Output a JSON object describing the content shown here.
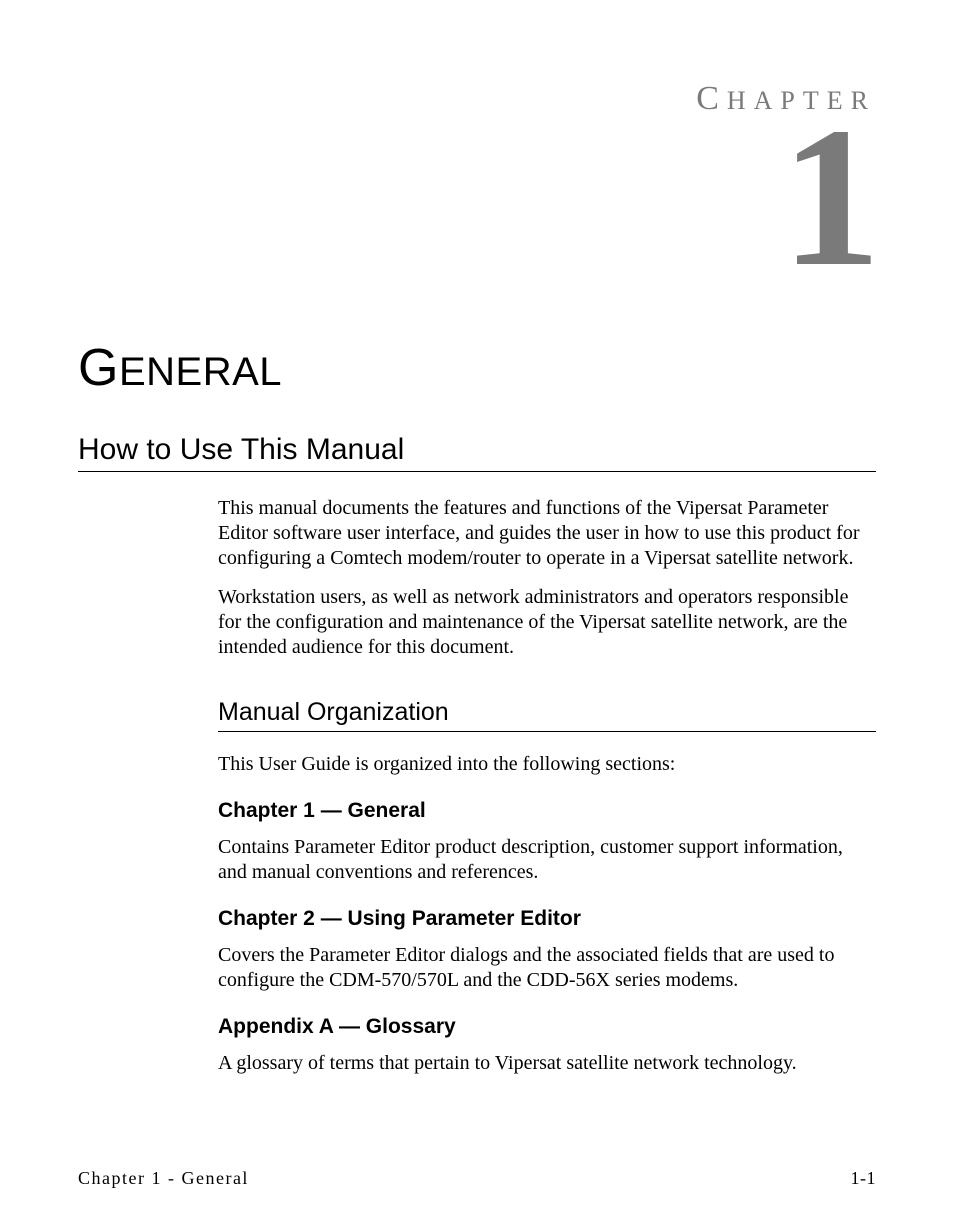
{
  "header": {
    "chapter_label": "HAPTER",
    "chapter_label_first": "C",
    "chapter_number": "1"
  },
  "chapter_title_first": "G",
  "chapter_title_rest": "ENERAL",
  "section_title": "How to Use This Manual",
  "intro_p1": "This manual documents the features and functions of the Vipersat Parameter Editor software user interface, and guides the user in how to use this product for configuring a Comtech modem/router to operate in a Vipersat satellite network.",
  "intro_p2": "Workstation users, as well as network administrators and operators responsible for the configuration and maintenance of the Vipersat satellite network, are the intended audience for this document.",
  "subsection_title": "Manual Organization",
  "sub_intro": "This User Guide is organized into the following sections:",
  "subsections": {
    "ch1_title": "Chapter 1 — General",
    "ch1_body": "Contains Parameter Editor product description, customer support information, and manual conventions and references.",
    "ch2_title": "Chapter 2 — Using Parameter Editor",
    "ch2_body": "Covers the Parameter Editor dialogs and the associated fields that are used to configure the CDM-570/570L and the CDD-56X series modems.",
    "appA_title": "Appendix A — Glossary",
    "appA_body": "A glossary of terms that pertain to Vipersat satellite network technology."
  },
  "footer": {
    "left": "Chapter 1 - General",
    "right": "1-1"
  }
}
